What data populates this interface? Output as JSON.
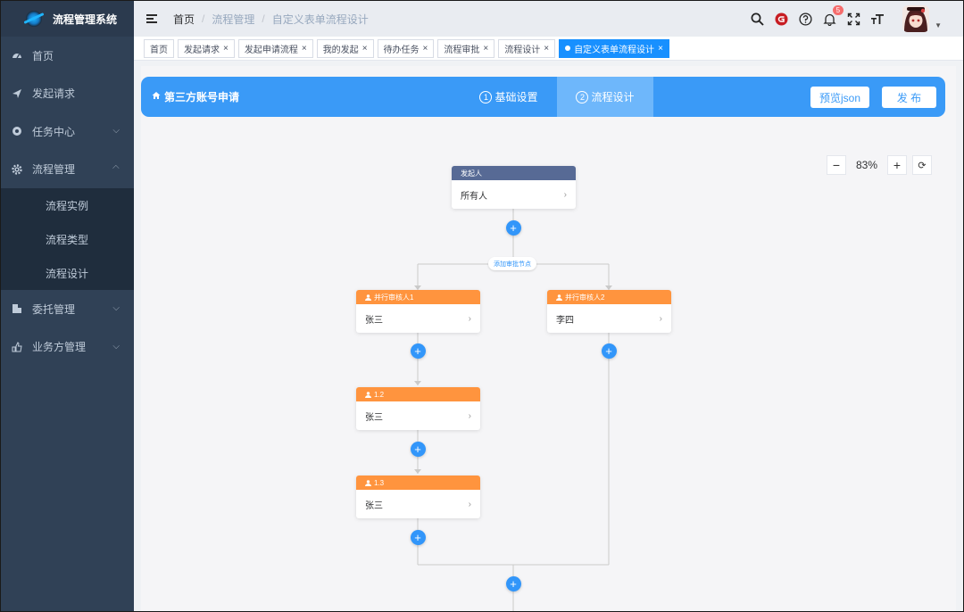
{
  "app": {
    "title": "流程管理系统"
  },
  "sidebar": {
    "items": [
      {
        "label": "首页",
        "icon": "dashboard-icon"
      },
      {
        "label": "发起请求",
        "icon": "send-icon"
      },
      {
        "label": "任务中心",
        "icon": "task-icon"
      },
      {
        "label": "流程管理",
        "icon": "gear-icon"
      },
      {
        "label": "委托管理",
        "icon": "delegate-icon"
      },
      {
        "label": "业务方管理",
        "icon": "business-icon"
      }
    ],
    "submenu": [
      "流程实例",
      "流程类型",
      "流程设计"
    ]
  },
  "header": {
    "breadcrumb": [
      "首页",
      "流程管理",
      "自定义表单流程设计"
    ],
    "notification_count": "5"
  },
  "tags": [
    {
      "label": "首页",
      "closable": false,
      "active": false
    },
    {
      "label": "发起请求",
      "closable": true,
      "active": false
    },
    {
      "label": "发起申请流程",
      "closable": true,
      "active": false
    },
    {
      "label": "我的发起",
      "closable": true,
      "active": false
    },
    {
      "label": "待办任务",
      "closable": true,
      "active": false
    },
    {
      "label": "流程审批",
      "closable": true,
      "active": false
    },
    {
      "label": "流程设计",
      "closable": true,
      "active": false
    },
    {
      "label": "自定义表单流程设计",
      "closable": true,
      "active": true
    }
  ],
  "designer": {
    "title": "第三方账号申请",
    "steps": [
      {
        "num": "1",
        "label": "基础设置"
      },
      {
        "num": "2",
        "label": "流程设计"
      }
    ],
    "preview_button": "预览json",
    "publish_button": "发 布",
    "zoom": "83%"
  },
  "flow": {
    "start": {
      "header": "发起人",
      "body": "所有人"
    },
    "add_branch_label": "添加审批节点",
    "left_branch": [
      {
        "header": "并行审核人1",
        "body": "张三"
      },
      {
        "header": "1.2",
        "body": "张三"
      },
      {
        "header": "1.3",
        "body": "张三"
      }
    ],
    "right_branch": [
      {
        "header": "并行审核人2",
        "body": "李四"
      }
    ]
  },
  "colors": {
    "sidebar_bg": "#304156",
    "accent": "#3a9af7",
    "start_node": "#576a95",
    "approver_node": "#ff943e",
    "plus_button": "#3296fa"
  }
}
